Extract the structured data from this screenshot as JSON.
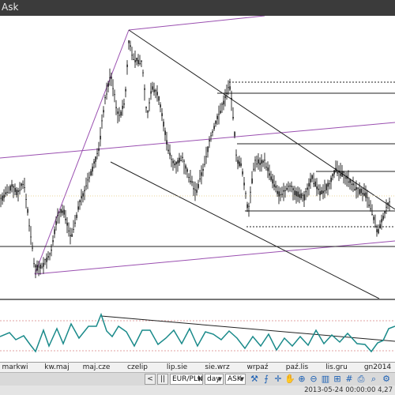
{
  "window": {
    "title": "Ask"
  },
  "chart_data": {
    "type": "candlestick",
    "x": [
      "markwi",
      "kw.maj",
      "maj.cze",
      "czelip",
      "lip.sie",
      "sie.wrz",
      "wrpaź",
      "paź.lis",
      "lis.gru",
      "gn2014"
    ],
    "overlays": [
      "trend channel",
      "horizontal levels"
    ],
    "oscillator": {
      "type": "line",
      "levels": [
        "upper dotted",
        "lower dotted"
      ]
    },
    "grid": false
  },
  "x_axis": {
    "labels": [
      "markwi",
      "kw.maj",
      "maj.cze",
      "czelip",
      "lip.sie",
      "sie.wrz",
      "wrpaź",
      "paź.lis",
      "lis.gru",
      "gn2014"
    ]
  },
  "toolbar": {
    "left_arrow": "<",
    "pause_icon": "pause-icon",
    "symbol": "EUR/PLN",
    "timeframe": "day",
    "price_type": "ASK"
  },
  "status": {
    "timestamp": "2013-05-24 00:00:00  4,27"
  },
  "colors": {
    "candle": "#000000",
    "channel": "#9a4fb0",
    "oscillator": "#1a8a8a",
    "level_dotted": "#e0a0a0"
  }
}
